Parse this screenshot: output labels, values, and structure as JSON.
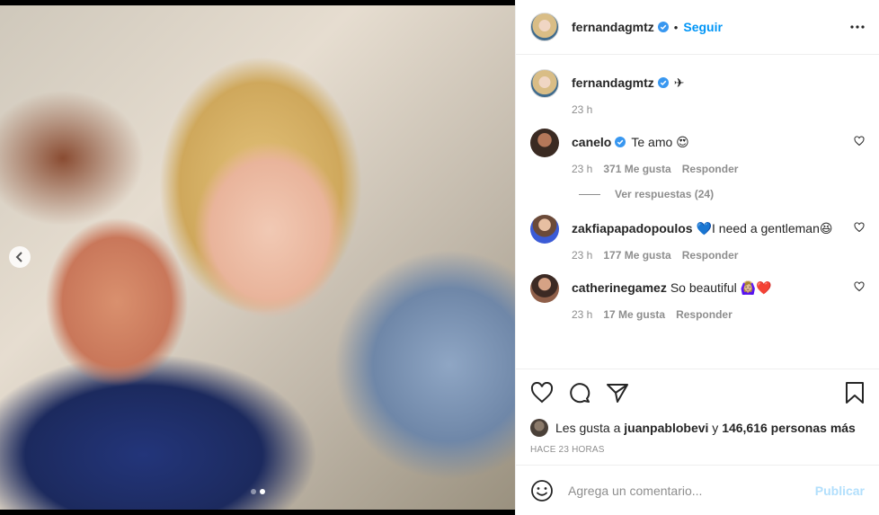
{
  "header": {
    "username": "fernandagmtz",
    "separator": "•",
    "follow_label": "Seguir"
  },
  "caption": {
    "username": "fernandagmtz",
    "text": "✈",
    "time": "23 h"
  },
  "comments": [
    {
      "username": "canelo",
      "verified": true,
      "text": "Te amo 😍",
      "time": "23 h",
      "likes": "371 Me gusta",
      "reply_label": "Responder",
      "view_replies": "Ver respuestas (24)"
    },
    {
      "username": "zakfiapapadopoulos",
      "verified": false,
      "text": "💙I need a gentleman😆",
      "time": "23 h",
      "likes": "177 Me gusta",
      "reply_label": "Responder"
    },
    {
      "username": "catherinegamez",
      "verified": false,
      "text": "So beautiful 🙆🏼‍♀️❤️",
      "time": "23 h",
      "likes": "17 Me gusta",
      "reply_label": "Responder"
    }
  ],
  "likes": {
    "prefix": "Les gusta a",
    "user": "juanpablobevi",
    "middle": "y",
    "count": "146,616 personas más"
  },
  "time_ago": "HACE 23 HORAS",
  "add_comment": {
    "placeholder": "Agrega un comentario...",
    "publish_label": "Publicar"
  },
  "carousel": {
    "total_slides": 2,
    "active_slide": 2
  },
  "colors": {
    "accent": "#0095f6",
    "publish_disabled": "#b2dffc",
    "verified": "#3897f0",
    "muted": "#8e8e8e"
  }
}
